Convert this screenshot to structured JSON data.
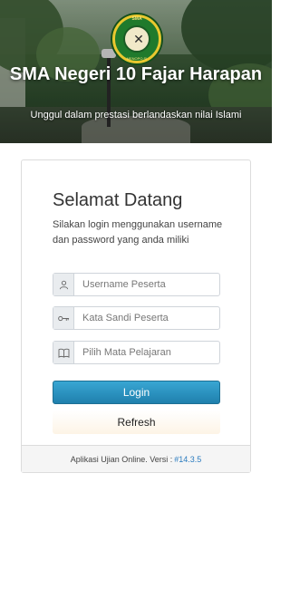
{
  "header": {
    "title": "SMA Negeri 10 Fajar Harapan",
    "tagline": "Unggul dalam prestasi berlandaskan nilai Islami",
    "logo": {
      "ring_top": "SMA",
      "ring_bottom": "MENOPO SI"
    }
  },
  "login": {
    "welcome": "Selamat Datang",
    "intro": "Silakan login menggunakan username dan password yang anda miliki",
    "username": {
      "placeholder": "Username Peserta",
      "icon": "user-icon"
    },
    "password": {
      "placeholder": "Kata Sandi Peserta",
      "icon": "key-icon"
    },
    "subject": {
      "placeholder": "Pilih Mata Pelajaran",
      "icon": "book-icon"
    },
    "login_button": "Login",
    "refresh_button": "Refresh"
  },
  "footer": {
    "text": "Aplikasi Ujian Online. Versi :",
    "version": "#14.3.5"
  },
  "colors": {
    "primary": "#2590c0",
    "footer_bg": "#f5f5f5",
    "version_link": "#2a7bbf"
  }
}
